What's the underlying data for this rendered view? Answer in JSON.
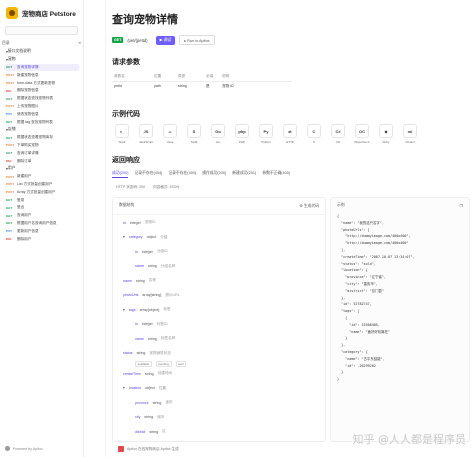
{
  "brand": {
    "name": "宠物商店 Petstore"
  },
  "sidebar": {
    "section_label": "目录",
    "items": [
      {
        "type": "folder",
        "label": "接口文档说明"
      },
      {
        "type": "folder",
        "label": "宠物"
      },
      {
        "method": "GET",
        "label": "查询宠物详情",
        "active": true
      },
      {
        "method": "POST",
        "label": "新建宠物信息"
      },
      {
        "method": "POST",
        "label": "form-data 方式更新宠物"
      },
      {
        "method": "DEL",
        "label": "删除宠物信息"
      },
      {
        "method": "GET",
        "label": "根据状态查找宠物列表"
      },
      {
        "method": "POST",
        "label": "上传宠物图片"
      },
      {
        "method": "PUT",
        "label": "修改宠物信息"
      },
      {
        "method": "GET",
        "label": "根据 tag 查找宠物列表"
      },
      {
        "type": "folder",
        "label": "店铺"
      },
      {
        "method": "GET",
        "label": "根据状态查看宠物库存"
      },
      {
        "method": "POST",
        "label": "下单购买宠物"
      },
      {
        "method": "GET",
        "label": "查询订单详情"
      },
      {
        "method": "DEL",
        "label": "删除订单"
      },
      {
        "type": "folder",
        "label": "用户"
      },
      {
        "method": "POST",
        "label": "新建用户"
      },
      {
        "method": "POST",
        "label": "List 方式批量创建用户"
      },
      {
        "method": "POST",
        "label": "Array 方式批量创建用户"
      },
      {
        "method": "GET",
        "label": "登录"
      },
      {
        "method": "GET",
        "label": "登出"
      },
      {
        "method": "GET",
        "label": "查询用户"
      },
      {
        "method": "GET",
        "label": "根据用户名查询用户信息"
      },
      {
        "method": "PUT",
        "label": "更新用户信息"
      },
      {
        "method": "DEL",
        "label": "删除用户"
      }
    ],
    "powered": "Powered by Apifox"
  },
  "header": {
    "title": "查询宠物详情",
    "method": "GET",
    "path": "/pet/{petId}",
    "try_label": "调试",
    "apifox_label": "Run in Apifox"
  },
  "request": {
    "heading": "请求参数",
    "columns": [
      "参数名",
      "位置",
      "类型",
      "必填",
      "说明"
    ],
    "rows": [
      [
        "petId",
        "path",
        "string",
        "是",
        "宠物 ID"
      ]
    ]
  },
  "examples": {
    "heading": "示例代码",
    "languages": [
      "Shell",
      "JavaScript",
      "Java",
      "Swift",
      "Go",
      "PHP",
      "Python",
      "HTTP",
      "C",
      "C#",
      "Objective-C",
      "Ruby",
      "OCaml"
    ]
  },
  "response": {
    "heading": "返回响应",
    "tabs": [
      "成功(200)",
      "记录不存在(404)",
      "记录不存在(400)",
      "操作成功(200)",
      "新建成功(201)",
      "参数不正确(400)"
    ],
    "status_label": "HTTP 状态码: 200",
    "content_type_label": "内容格式: JSON",
    "schema_title": "数据结构",
    "example_title": "示例",
    "expand_label": "生成代码",
    "fields": [
      {
        "name": "id",
        "type": "integer",
        "desc": "宠物ID",
        "level": 1
      },
      {
        "name": "category",
        "type": "object",
        "desc": "分组",
        "level": 1
      },
      {
        "name": "id",
        "type": "integer",
        "desc": "分组ID",
        "level": 2
      },
      {
        "name": "name",
        "type": "string",
        "desc": "分组名称",
        "level": 2
      },
      {
        "name": "name",
        "type": "string",
        "desc": "名称",
        "level": 1
      },
      {
        "name": "photoUrls",
        "type": "array[string]",
        "desc": "照片URL",
        "level": 1
      },
      {
        "name": "tags",
        "type": "array[object]",
        "desc": "标签",
        "level": 1
      },
      {
        "name": "id",
        "type": "integer",
        "desc": "标签ID",
        "level": 2
      },
      {
        "name": "name",
        "type": "string",
        "desc": "标签名称",
        "level": 2
      },
      {
        "name": "status",
        "type": "string",
        "desc": "宠物销售状态",
        "level": 1
      },
      {
        "name": "createTime",
        "type": "string",
        "desc": "创建时间",
        "level": 1
      },
      {
        "name": "location",
        "type": "object",
        "desc": "位置",
        "level": 1
      },
      {
        "name": "province",
        "type": "string",
        "desc": "省份",
        "level": 2
      },
      {
        "name": "city",
        "type": "string",
        "desc": "城市",
        "level": 2
      },
      {
        "name": "district",
        "type": "string",
        "desc": "区",
        "level": 2
      }
    ],
    "status_enum": [
      "available",
      "pending",
      "sold"
    ],
    "example_lines": [
      "{",
      "  \"name\": \"我的这只名字\",",
      "  \"photoUrls\": [",
      "    \"http://dummyimage.com/400x400\",",
      "    \"http://dummyimage.com/400x400\"",
      "  ],",
      "  \"createTime\": \"2007-10-07 13:34:07\",",
      "  \"status\": \"sold\",",
      "  \"location\": {",
      "    \"province\": \"辽宁省\",",
      "    \"city\": \"重庆市\",",
      "    \"district\": \"巨门县\"",
      "  },",
      "  \"id\": 52782747,",
      "  \"tags\": [",
      "    {",
      "      \"id\": 15508405,",
      "      \"name\": \"面好好机离在\"",
      "    }",
      "  ],",
      "  \"category\": {",
      "    \"name\": \"古平东结能\",",
      "    \"id\": -26299282",
      "  }",
      "}"
    ]
  },
  "footer": {
    "text": "Apifox  在线宠物商店 Apifox 生成"
  },
  "watermark": "知乎 @人人都是程序员"
}
